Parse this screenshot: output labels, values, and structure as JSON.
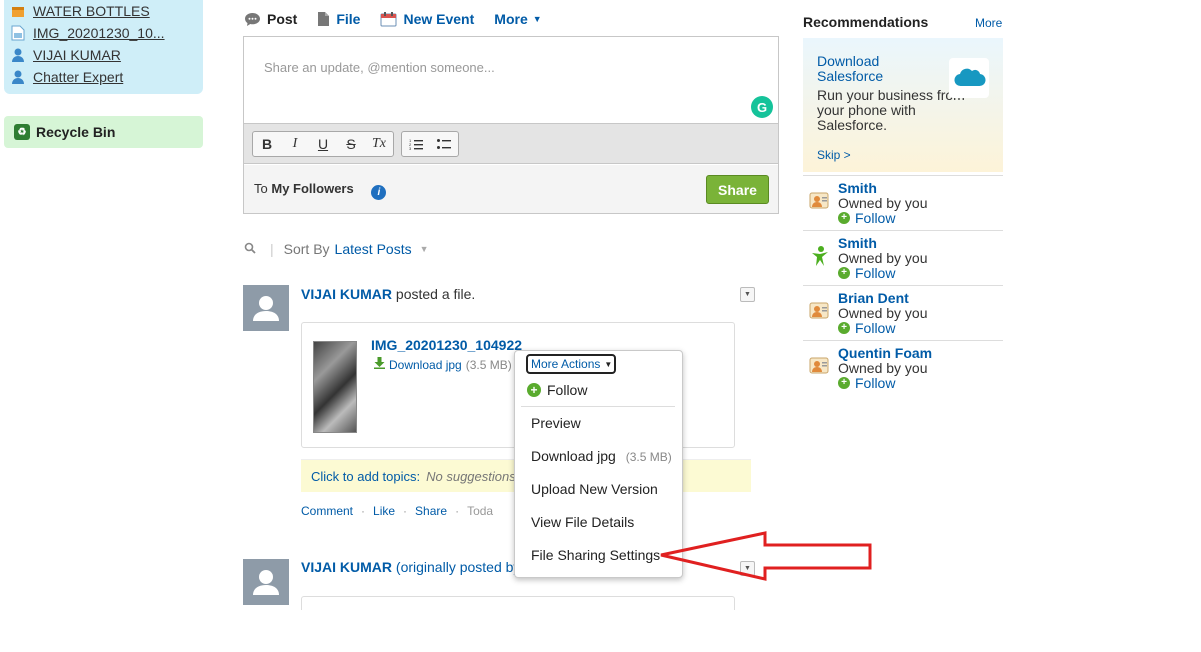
{
  "sidebar": {
    "items": [
      {
        "label": "WATER BOTTLES",
        "icon": "product-icon"
      },
      {
        "label": "IMG_20201230_10...",
        "icon": "file-icon"
      },
      {
        "label": "VIJAI KUMAR",
        "icon": "user-icon"
      },
      {
        "label": "Chatter Expert",
        "icon": "user-icon"
      }
    ],
    "recycle_bin": "Recycle Bin"
  },
  "publisher": {
    "tabs": [
      {
        "label": "Post",
        "icon": "speech-bubble-icon"
      },
      {
        "label": "File",
        "icon": "document-icon"
      },
      {
        "label": "New Event",
        "icon": "calendar-icon"
      },
      {
        "label": "More",
        "icon": "chevron-down-icon"
      }
    ],
    "placeholder": "Share an update, @mention someone...",
    "to_prefix": "To",
    "audience": "My Followers",
    "share_label": "Share",
    "toolbar": [
      "B",
      "I",
      "U",
      "S",
      "Tx"
    ]
  },
  "sort": {
    "label": "Sort By",
    "value": "Latest Posts"
  },
  "feed": {
    "item1": {
      "author": "VIJAI KUMAR",
      "action": "posted a file.",
      "file_name": "IMG_20201230_104922",
      "download_label": "Download jpg",
      "file_size": "(3.5 MB)",
      "topics_add": "Click to add topics:",
      "topics_none": "No suggestions",
      "actions": {
        "comment": "Comment",
        "like": "Like",
        "share": "Share",
        "date": "Toda"
      }
    },
    "item2": {
      "author": "VIJAI KUMAR",
      "action": "(originally posted by"
    }
  },
  "dropdown": {
    "title": "More Actions",
    "follow": "Follow",
    "items": [
      {
        "label": "Preview"
      },
      {
        "label": "Download jpg",
        "size": "(3.5 MB)"
      },
      {
        "label": "Upload New Version"
      },
      {
        "label": "View File Details"
      },
      {
        "label": "File Sharing Settings"
      }
    ]
  },
  "recommendations": {
    "title": "Recommendations",
    "more": "More",
    "card": {
      "title": "Download Salesforce",
      "description": "Run your business from your phone with Salesforce.",
      "skip": "Skip >"
    },
    "people": [
      {
        "name": "Smith",
        "owner": "Owned by you",
        "follow": "Follow",
        "icon": "contact-card-icon"
      },
      {
        "name": "Smith",
        "owner": "Owned by you",
        "follow": "Follow",
        "icon": "person-green-icon"
      },
      {
        "name": "Brian Dent",
        "owner": "Owned by you",
        "follow": "Follow",
        "icon": "contact-card-icon"
      },
      {
        "name": "Quentin Foam",
        "owner": "Owned by you",
        "follow": "Follow",
        "icon": "contact-card-icon"
      }
    ]
  },
  "colors": {
    "link": "#015ba7",
    "share_button": "#7ab338",
    "annotation_arrow": "#e02020",
    "sidebar_bg": "#cfeef8",
    "recycle_bg": "#d6f5d6"
  }
}
